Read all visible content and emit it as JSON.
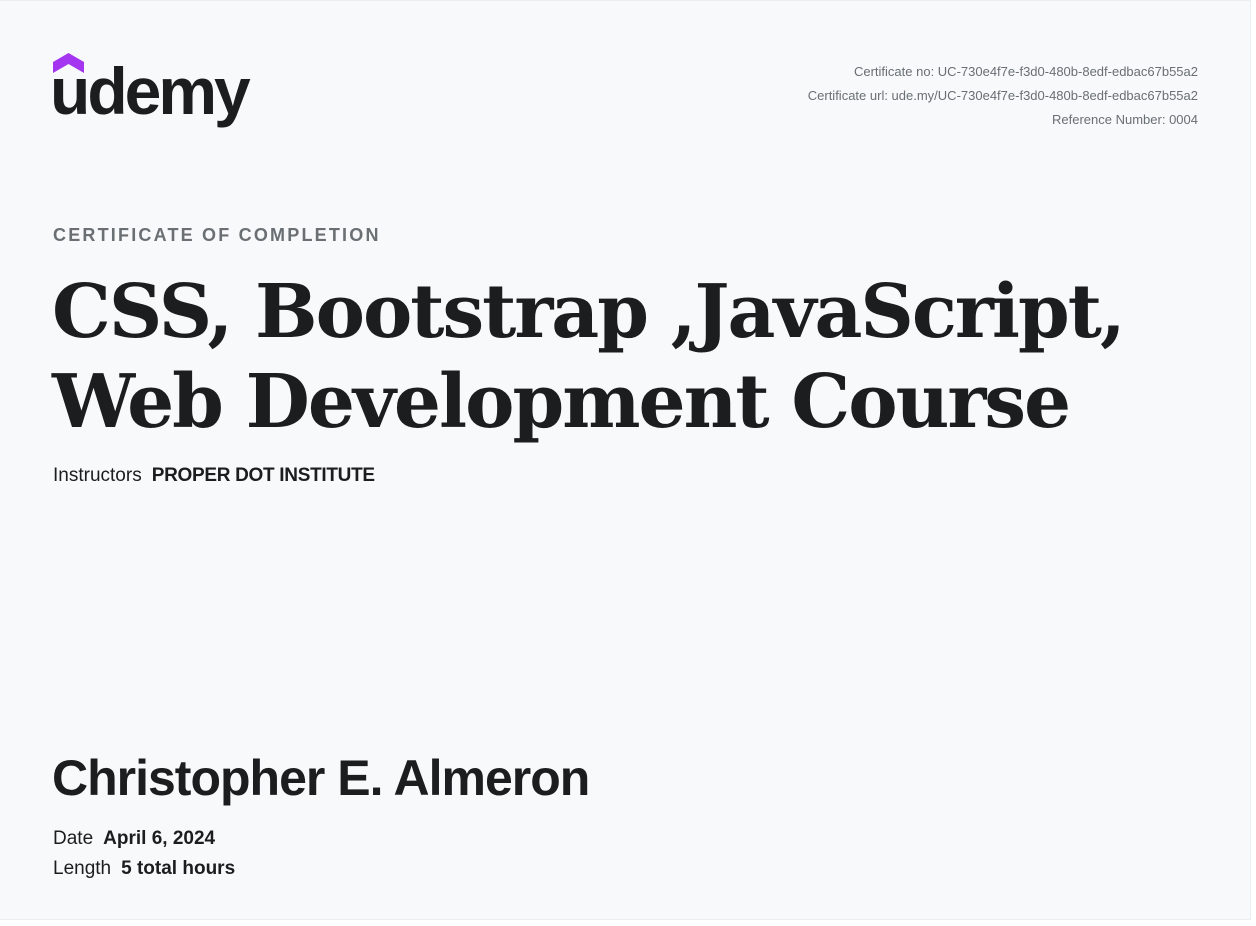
{
  "brand": {
    "name": "udemy",
    "accent_color": "#a435f0",
    "text_color": "#1c1d1f"
  },
  "meta": {
    "certificate_no": "Certificate no: UC-730e4f7e-f3d0-480b-8edf-edbac67b55a2",
    "certificate_url": "Certificate url: ude.my/UC-730e4f7e-f3d0-480b-8edf-edbac67b55a2",
    "reference_number": "Reference Number: 0004"
  },
  "eyebrow": "CERTIFICATE OF COMPLETION",
  "course": {
    "title_line_1": "CSS, Bootstrap ,JavaScript,",
    "title_line_2": "Web Development Course"
  },
  "instructors": {
    "label": "Instructors",
    "value": "PROPER DOT INSTITUTE"
  },
  "recipient": {
    "name": "Christopher E. Almeron"
  },
  "details": {
    "date_label": "Date",
    "date_value": "April 6, 2024",
    "length_label": "Length",
    "length_value": "5 total hours"
  }
}
